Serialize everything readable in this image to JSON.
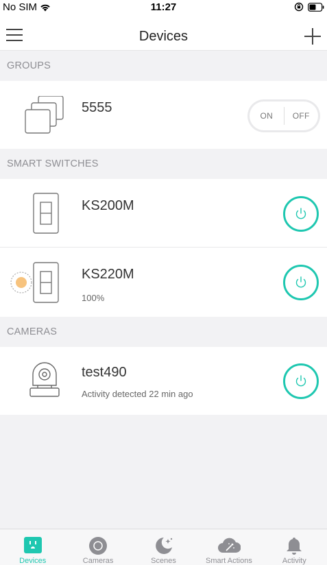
{
  "status_bar": {
    "carrier": "No SIM",
    "time": "11:27"
  },
  "nav": {
    "title": "Devices"
  },
  "sections": {
    "groups": "GROUPS",
    "smart_switches": "SMART SWITCHES",
    "cameras": "CAMERAS"
  },
  "groups": [
    {
      "name": "5555",
      "on_label": "ON",
      "off_label": "OFF"
    }
  ],
  "switches": [
    {
      "name": "KS200M"
    },
    {
      "name": "KS220M",
      "subtitle": "100%"
    }
  ],
  "cameras": [
    {
      "name": "test490",
      "subtitle": "Activity detected 22 min ago"
    }
  ],
  "tabs": [
    {
      "label": "Devices",
      "icon": "plug-icon",
      "active": true
    },
    {
      "label": "Cameras",
      "icon": "camera-icon",
      "active": false
    },
    {
      "label": "Scenes",
      "icon": "moon-stars-icon",
      "active": false
    },
    {
      "label": "Smart Actions",
      "icon": "cloud-wand-icon",
      "active": false
    },
    {
      "label": "Activity",
      "icon": "bell-icon",
      "active": false
    }
  ],
  "colors": {
    "accent": "#1ec7b0",
    "dimmer_dot": "#f7c37e"
  }
}
